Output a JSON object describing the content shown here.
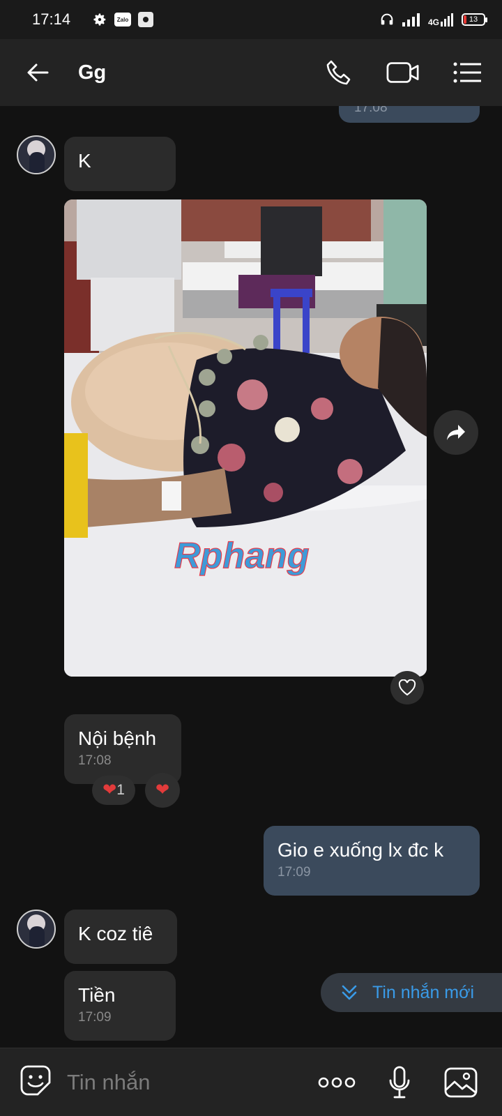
{
  "status_bar": {
    "time": "17:14",
    "zalo_label": "Zalo",
    "network": "4G",
    "battery": "13"
  },
  "header": {
    "title": "Gg"
  },
  "messages": [
    {
      "id": "prev-out-time",
      "direction": "out",
      "time": "17:08"
    },
    {
      "id": "m1",
      "direction": "in",
      "text": "K"
    },
    {
      "id": "m2",
      "direction": "in",
      "type": "image",
      "watermark": "Rphang"
    },
    {
      "id": "m3",
      "direction": "in",
      "text": "Nội bệnh",
      "time": "17:08",
      "reaction_count": "1"
    },
    {
      "id": "m4",
      "direction": "out",
      "text": "Gio e xuống lx đc k",
      "time": "17:09"
    },
    {
      "id": "m5",
      "direction": "in",
      "text": "K coz tiê"
    },
    {
      "id": "m6",
      "direction": "in",
      "text": "Tiền",
      "time": "17:09"
    }
  ],
  "new_messages_pill": {
    "label": "Tin nhắn mới"
  },
  "composer": {
    "placeholder": "Tin nhắn"
  },
  "colors": {
    "background": "#121212",
    "bar": "#232323",
    "bubble_in": "#2b2b2b",
    "bubble_out": "#3b4a5c",
    "accent": "#3a9be8",
    "heart": "#e23b3b"
  }
}
